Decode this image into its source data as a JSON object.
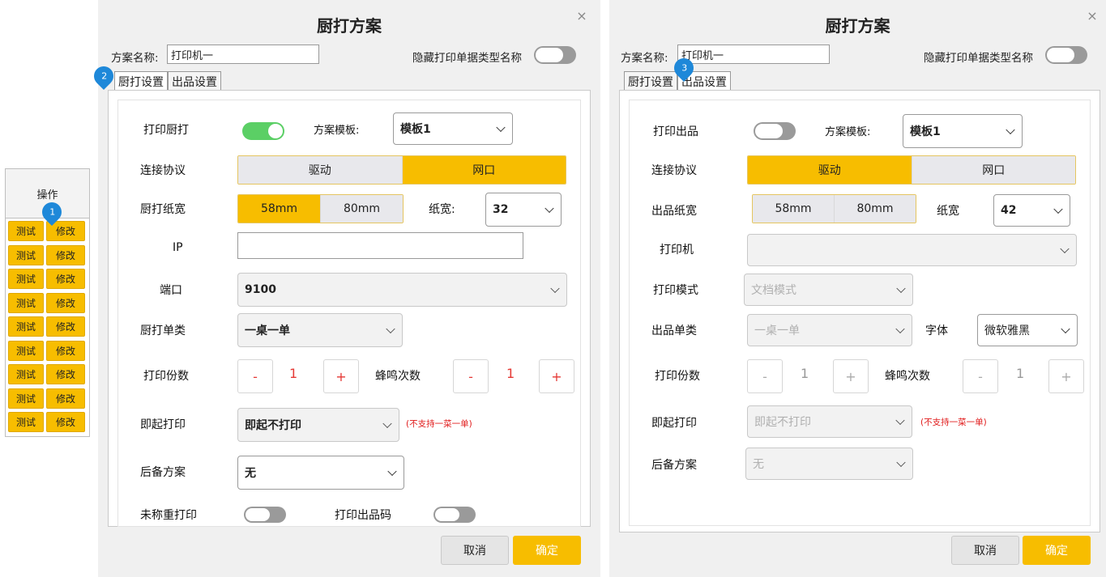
{
  "ops_table": {
    "header": "操作",
    "rows": [
      {
        "test": "测试",
        "edit": "修改"
      },
      {
        "test": "测试",
        "edit": "修改"
      },
      {
        "test": "测试",
        "edit": "修改"
      },
      {
        "test": "测试",
        "edit": "修改"
      },
      {
        "test": "测试",
        "edit": "修改"
      },
      {
        "test": "测试",
        "edit": "修改"
      },
      {
        "test": "测试",
        "edit": "修改"
      },
      {
        "test": "测试",
        "edit": "修改"
      },
      {
        "test": "测试",
        "edit": "修改"
      }
    ]
  },
  "markers": [
    "1",
    "2",
    "3"
  ],
  "dialog_left": {
    "title": "厨打方案",
    "close": "×",
    "scheme_name_label": "方案名称:",
    "scheme_name_value": "打印机一",
    "hide_type_label": "隐藏打印单据类型名称",
    "tabs": [
      "厨打设置",
      "出品设置"
    ],
    "print_kitchen_label": "打印厨打",
    "template_label": "方案模板:",
    "template_value": "模板1",
    "protocol_label": "连接协议",
    "protocol_options": [
      "驱动",
      "网口"
    ],
    "paper_label": "厨打纸宽",
    "paper_options": [
      "58mm",
      "80mm"
    ],
    "width_label": "纸宽:",
    "width_value": "32",
    "ip_label": "IP",
    "ip_value": "",
    "port_label": "端口",
    "port_value": "9100",
    "order_type_label": "厨打单类",
    "order_type_value": "一桌一单",
    "copies_label": "打印份数",
    "copies_value": "1",
    "beep_label": "蜂鸣次数",
    "beep_value": "1",
    "minus": "-",
    "plus": "+",
    "immediate_label": "即起打印",
    "immediate_value": "即起不打印",
    "immediate_note": "(不支持一菜一单)",
    "backup_label": "后备方案",
    "backup_value": "无",
    "unweighed_label": "未称重打印",
    "print_code_label": "打印出品码",
    "cancel": "取消",
    "ok": "确定"
  },
  "dialog_right": {
    "title": "厨打方案",
    "close": "×",
    "scheme_name_label": "方案名称:",
    "scheme_name_value": "打印机一",
    "hide_type_label": "隐藏打印单据类型名称",
    "tabs": [
      "厨打设置",
      "出品设置"
    ],
    "print_output_label": "打印出品",
    "template_label": "方案模板:",
    "template_value": "模板1",
    "protocol_label": "连接协议",
    "protocol_options": [
      "驱动",
      "网口"
    ],
    "paper_label": "出品纸宽",
    "paper_options": [
      "58mm",
      "80mm"
    ],
    "width_label": "纸宽",
    "width_value": "42",
    "printer_label": "打印机",
    "printer_value": "",
    "mode_label": "打印模式",
    "mode_value": "文档模式",
    "order_type_label": "出品单类",
    "order_type_value": "一桌一单",
    "font_label": "字体",
    "font_value": "微软雅黑",
    "copies_label": "打印份数",
    "copies_value": "1",
    "beep_label": "蜂鸣次数",
    "beep_value": "1",
    "minus": "-",
    "plus": "+",
    "immediate_label": "即起打印",
    "immediate_value": "即起不打印",
    "immediate_note": "(不支持一菜一单)",
    "backup_label": "后备方案",
    "backup_value": "无",
    "cancel": "取消",
    "ok": "确定"
  }
}
